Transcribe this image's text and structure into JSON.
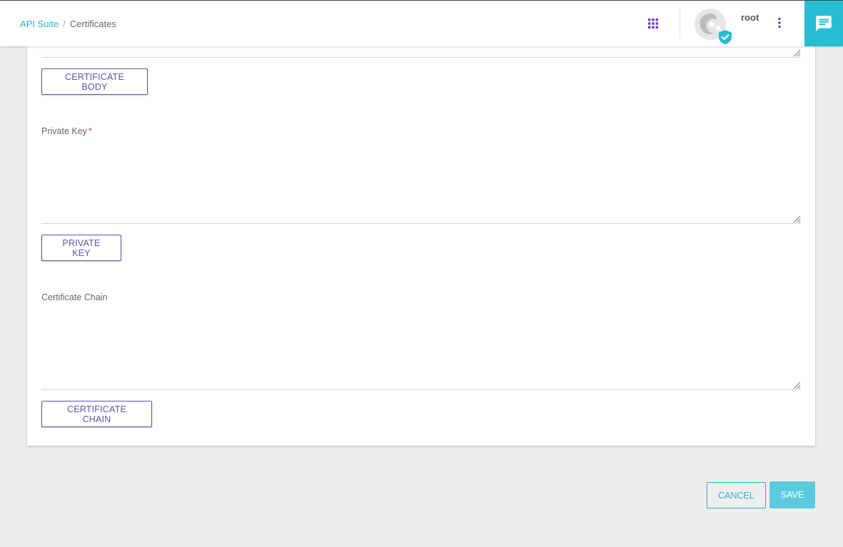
{
  "header": {
    "breadcrumb": {
      "parent": "API Suite",
      "separator": "/",
      "current": "Certificates"
    },
    "user": {
      "name": "root"
    },
    "icons": {
      "apps": "apps-grid-icon",
      "more": "more-vert-icon",
      "chat": "chat-icon",
      "verified": "verified-check-icon"
    }
  },
  "form": {
    "certificate_body_button": "CERTIFICATE BODY",
    "private_key": {
      "label": "Private Key",
      "required_marker": "*",
      "value": "",
      "button": "PRIVATE KEY"
    },
    "certificate_chain": {
      "label": "Certificate Chain",
      "value": "",
      "button": "CERTIFICATE CHAIN"
    }
  },
  "footer": {
    "cancel": "CANCEL",
    "save": "SAVE"
  },
  "colors": {
    "accent": "#26b5cc",
    "primary": "#5c55a8",
    "apps_icon": "#6a3fb5",
    "chat_bg": "#26bdd4",
    "save_bg": "#54cbe0",
    "background": "#eeeeee"
  }
}
